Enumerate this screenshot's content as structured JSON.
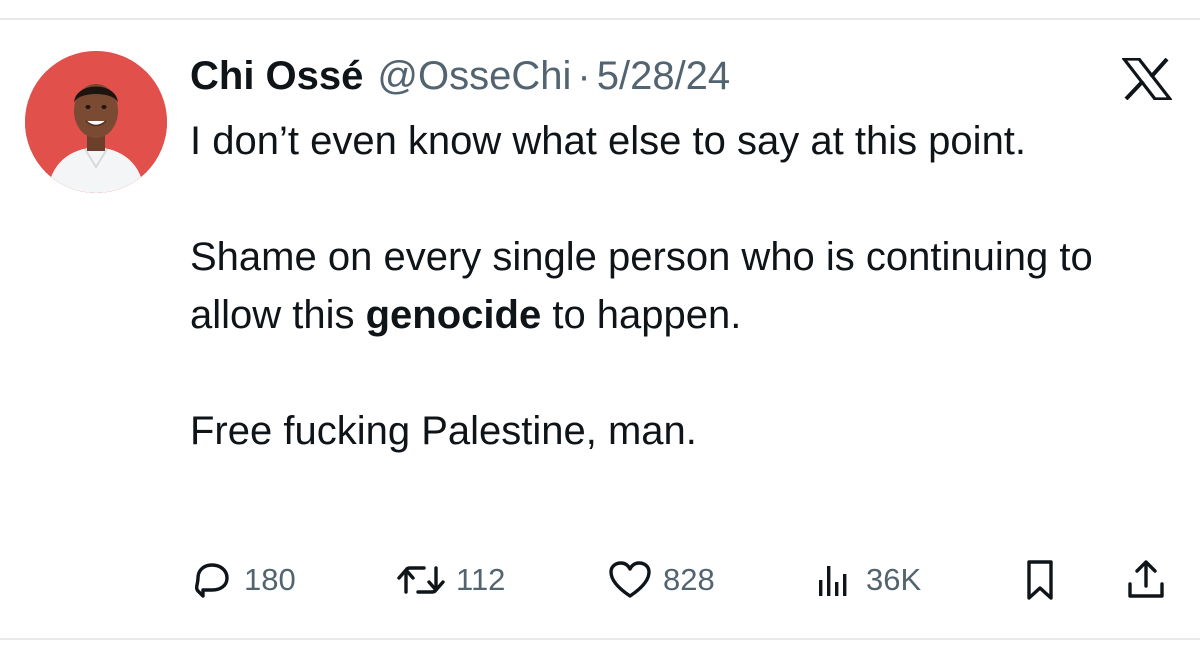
{
  "author": {
    "display_name": "Chi Ossé",
    "handle": "@OsseChi",
    "separator": "·",
    "date": "5/28/24"
  },
  "tweet": {
    "line1": "I don’t even know what else to say at this point.",
    "line2_before": "Shame on every single person who is continuing to allow this ",
    "line2_bold": "genocide",
    "line2_after": " to happen.",
    "line3": "Free fucking Palestine, man."
  },
  "metrics": {
    "replies": "180",
    "reposts": "112",
    "likes": "828",
    "views": "36K"
  },
  "icons": {
    "reply": "reply-icon",
    "repost": "repost-icon",
    "like": "heart-icon",
    "views": "views-icon",
    "bookmark": "bookmark-icon",
    "share": "share-icon",
    "brand": "x-logo-icon"
  },
  "colors": {
    "text_primary": "#0f1419",
    "text_secondary": "#536471",
    "avatar_background": "#e2504c"
  }
}
